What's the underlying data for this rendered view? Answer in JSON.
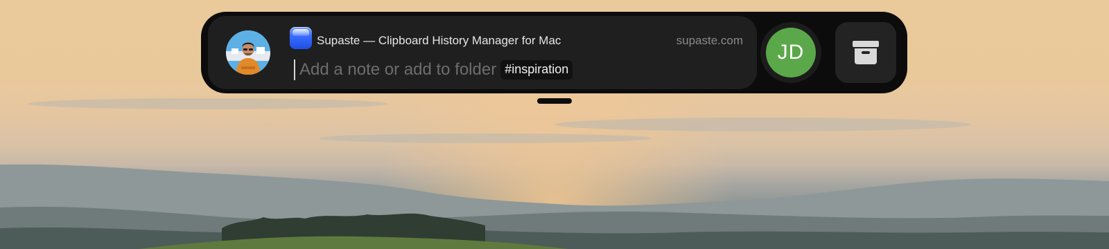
{
  "clip": {
    "source_title": "Supaste — Clipboard History Manager for Mac",
    "source_domain": "supaste.com",
    "app_icon": "supaste-app-icon"
  },
  "note": {
    "placeholder": "Add a note or add to folder",
    "tag": "#inspiration"
  },
  "user": {
    "initials": "JD",
    "avatar_color": "#5aa84a"
  },
  "actions": {
    "archive_icon": "archive-box-icon"
  },
  "colors": {
    "panel": "#0d0c0c",
    "card": "#1f1f1f"
  }
}
